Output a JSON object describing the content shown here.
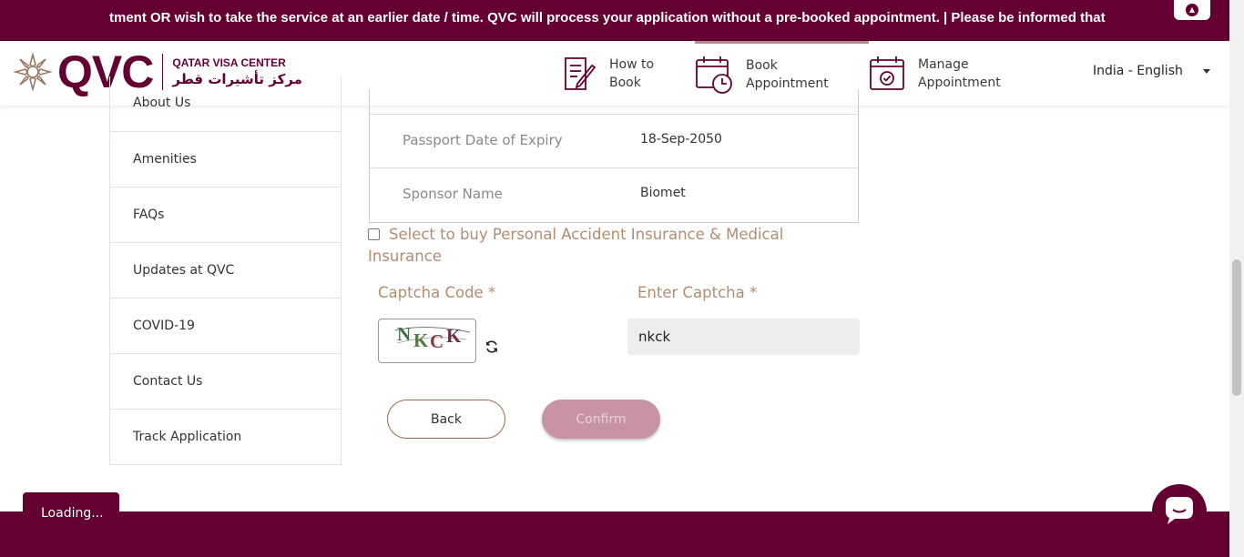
{
  "ticker": {
    "text": "tment OR wish to take the service at an earlier date / time. QVC will process your application without a pre-booked appointment. | Please be informed that"
  },
  "header": {
    "logo_text": "QVC",
    "logo_en": "QATAR VISA CENTER",
    "logo_ar": "مركز تأشيرات قطر",
    "nav": [
      {
        "line1": "How to",
        "line2": "Book",
        "icon": "document-edit-icon"
      },
      {
        "line1": "Book",
        "line2": "Appointment",
        "icon": "calendar-clock-icon"
      },
      {
        "line1": "Manage",
        "line2": "Appointment",
        "icon": "calendar-check-icon"
      }
    ],
    "language": "India - English"
  },
  "sidebar": {
    "items": [
      {
        "label": "About Us"
      },
      {
        "label": "Amenities"
      },
      {
        "label": "FAQs"
      },
      {
        "label": "Updates at QVC"
      },
      {
        "label": "COVID-19"
      },
      {
        "label": "Contact Us"
      },
      {
        "label": "Track Application"
      }
    ]
  },
  "details": [
    {
      "label": "Passport Date of Expiry",
      "value": "18-Sep-2050"
    },
    {
      "label": "Sponsor Name",
      "value": "Biomet"
    }
  ],
  "insurance": {
    "label": "Select to buy Personal Accident Insurance & Medical Insurance",
    "checked": false
  },
  "captcha": {
    "code_label": "Captcha Code *",
    "enter_label": "Enter Captcha *",
    "chars": [
      "N",
      "K",
      "C",
      "K"
    ],
    "input_value": "nkck"
  },
  "buttons": {
    "back": "Back",
    "confirm": "Confirm"
  },
  "loading_text": "Loading...",
  "colors": {
    "brand": "#630031",
    "accent_text": "#b58c70",
    "confirm_disabled": "#c893a4"
  }
}
